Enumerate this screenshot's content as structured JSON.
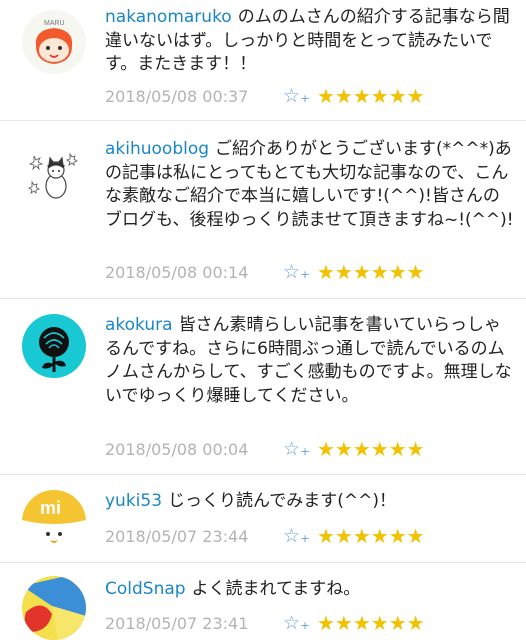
{
  "comments": [
    {
      "username": "nakanomaruko",
      "text": "のムのムさんの紹介する記事なら間違いないはず。しっかりと時間をとって読みたいです。またきます！！",
      "timestamp": "2018/05/08 00:37",
      "avatar": "girl-face-avatar",
      "stars": "★★★★★★"
    },
    {
      "username": "akihuooblog",
      "text": "ご紹介ありがとうございます(*^^*)あの記事は私にとってもとても大切な記事なので、こんな素敵なご紹介で本当に嬉しいです!(^^)!皆さんのブログも、後程ゆっくり読ませて頂きますね~!(^^)!",
      "timestamp": "2018/05/08 00:14",
      "avatar": "cat-sketch-avatar",
      "stars": "★★★★★★"
    },
    {
      "username": "akokura",
      "text": "皆さん素晴らしい記事を書いていらっしゃるんですね。さらに6時間ぶっ通しで読んでいるのムノムさんからして、すごく感動ものですよ。無理しないでゆっくり爆睡してください。",
      "timestamp": "2018/05/08 00:04",
      "avatar": "rose-avatar",
      "stars": "★★★★★★"
    },
    {
      "username": "yuki53",
      "text": "じっくり読んでみます(^^)！",
      "timestamp": "2018/05/07 23:44",
      "avatar": "mi-chick-avatar",
      "stars": "★★★★★★"
    },
    {
      "username": "ColdSnap",
      "text": "よく読まれてますね。",
      "timestamp": "2018/05/07 23:41",
      "avatar": "abstract-avatar",
      "stars": "★★★★★★"
    }
  ],
  "avatar_text": {
    "maru": "MARU",
    "mi": "mi"
  },
  "colors": {
    "username": "#1a87c5",
    "timestamp": "#b3b3b3",
    "star": "#f2c200",
    "star_add": "#6aa3e0"
  }
}
